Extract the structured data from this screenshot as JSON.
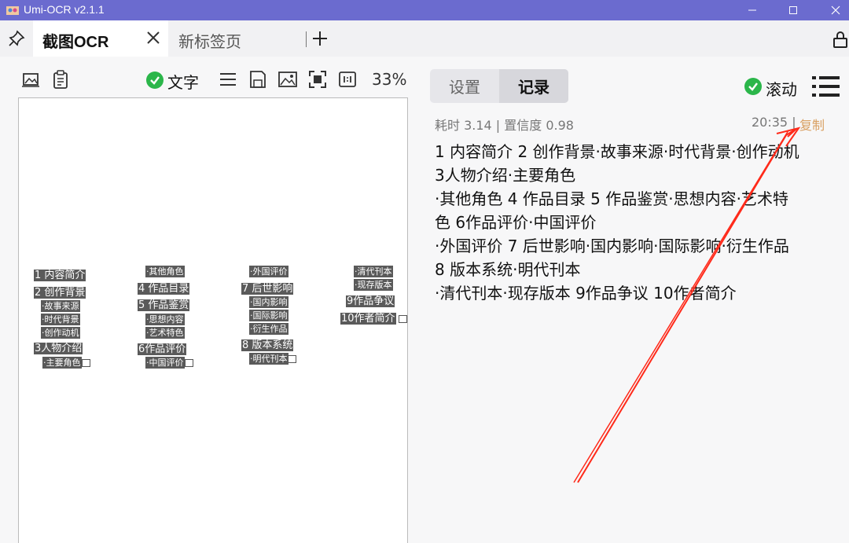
{
  "window": {
    "title": "Umi-OCR v2.1.1"
  },
  "tabs": {
    "active_label": "截图OCR",
    "new_tab_label": "新标签页"
  },
  "toolbar": {
    "text_toggle_label": "文字",
    "text_toggle_checked": true,
    "zoom": "33%"
  },
  "ocr_preview": {
    "blocks": [
      {
        "text": "1 内容简介"
      },
      {
        "text": "2 创作背景"
      },
      {
        "text": "·故事来源"
      },
      {
        "text": "·时代背景"
      },
      {
        "text": "·创作动机"
      },
      {
        "text": "3人物介绍"
      },
      {
        "text": "·主要角色"
      },
      {
        "text": "·其他角色"
      },
      {
        "text": "4 作品目录"
      },
      {
        "text": "5 作品鉴赏"
      },
      {
        "text": "·思想内容"
      },
      {
        "text": "·艺术特色"
      },
      {
        "text": "6作品评价"
      },
      {
        "text": "·中国评价"
      },
      {
        "text": "·外国评价"
      },
      {
        "text": "7 后世影响"
      },
      {
        "text": "·国内影响"
      },
      {
        "text": "·国际影响"
      },
      {
        "text": "·衍生作品"
      },
      {
        "text": "8 版本系统"
      },
      {
        "text": "·明代刊本"
      },
      {
        "text": "·清代刊本"
      },
      {
        "text": "·现存版本"
      },
      {
        "text": "9作品争议"
      },
      {
        "text": "10作者简介"
      }
    ]
  },
  "right_panel": {
    "tab_settings": "设置",
    "tab_records": "记录",
    "scroll_toggle_label": "滚动",
    "scroll_toggle_checked": true,
    "record": {
      "meta": "耗时 3.14 | 置信度 0.98",
      "time": "20:35 |",
      "copy": "复制",
      "lines": [
        "1 内容简介 2 创作背景·故事来源·时代背景·创作动机",
        "3人物介绍·主要角色",
        "·其他角色 4 作品目录 5 作品鉴赏·思想内容·艺术特",
        "色 6作品评价·中国评价",
        "·外国评价 7 后世影响·国内影响·国际影响·衍生作品",
        "8 版本系统·明代刊本",
        "·清代刊本·现存版本 9作品争议 10作者简介"
      ]
    }
  },
  "colors": {
    "titlebar": "#6b6bcf",
    "check": "#2bb64a",
    "copy_link": "#d9a062",
    "annotation_arrow": "#ff2a1a"
  }
}
